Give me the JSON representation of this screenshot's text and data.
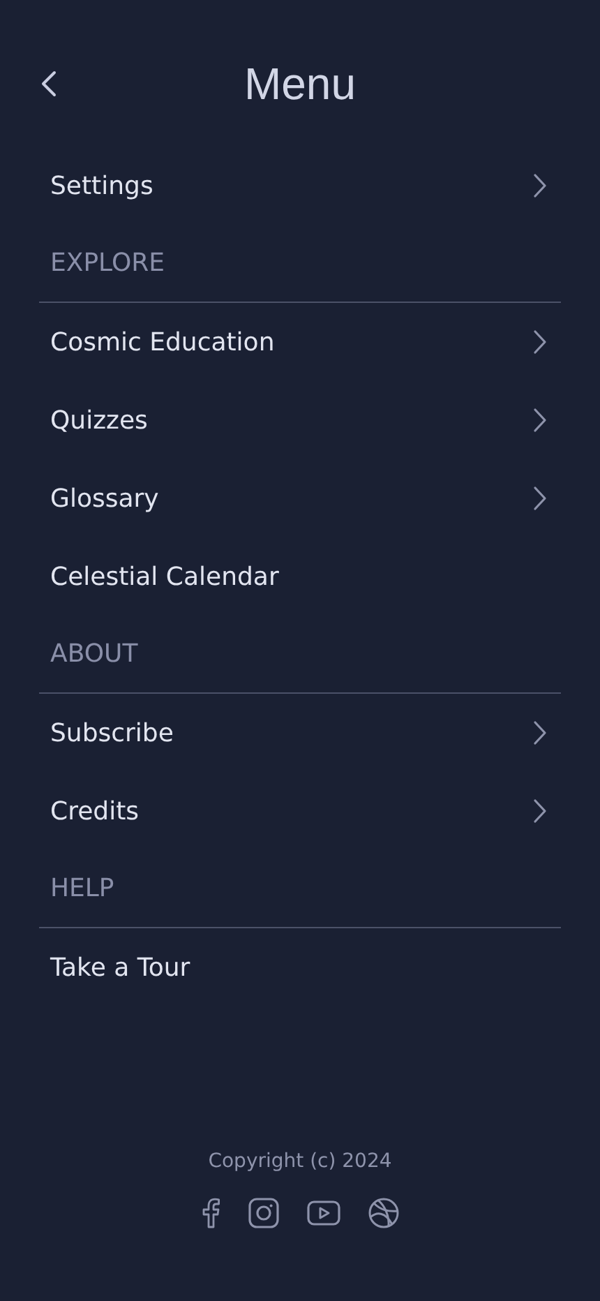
{
  "header": {
    "title": "Menu"
  },
  "items": [
    {
      "kind": "link",
      "label": "Settings",
      "arrow": true
    },
    {
      "kind": "section",
      "label": "EXPLORE"
    },
    {
      "kind": "link",
      "label": "Cosmic Education",
      "arrow": true
    },
    {
      "kind": "link",
      "label": "Quizzes",
      "arrow": true
    },
    {
      "kind": "link",
      "label": "Glossary",
      "arrow": true
    },
    {
      "kind": "link",
      "label": "Celestial Calendar",
      "arrow": false
    },
    {
      "kind": "section",
      "label": "ABOUT"
    },
    {
      "kind": "link",
      "label": "Subscribe",
      "arrow": true
    },
    {
      "kind": "link",
      "label": "Credits",
      "arrow": true
    },
    {
      "kind": "section",
      "label": "HELP"
    },
    {
      "kind": "link",
      "label": "Take a Tour",
      "arrow": false
    }
  ],
  "footer": {
    "copyright": "Copyright (c) 2024"
  }
}
